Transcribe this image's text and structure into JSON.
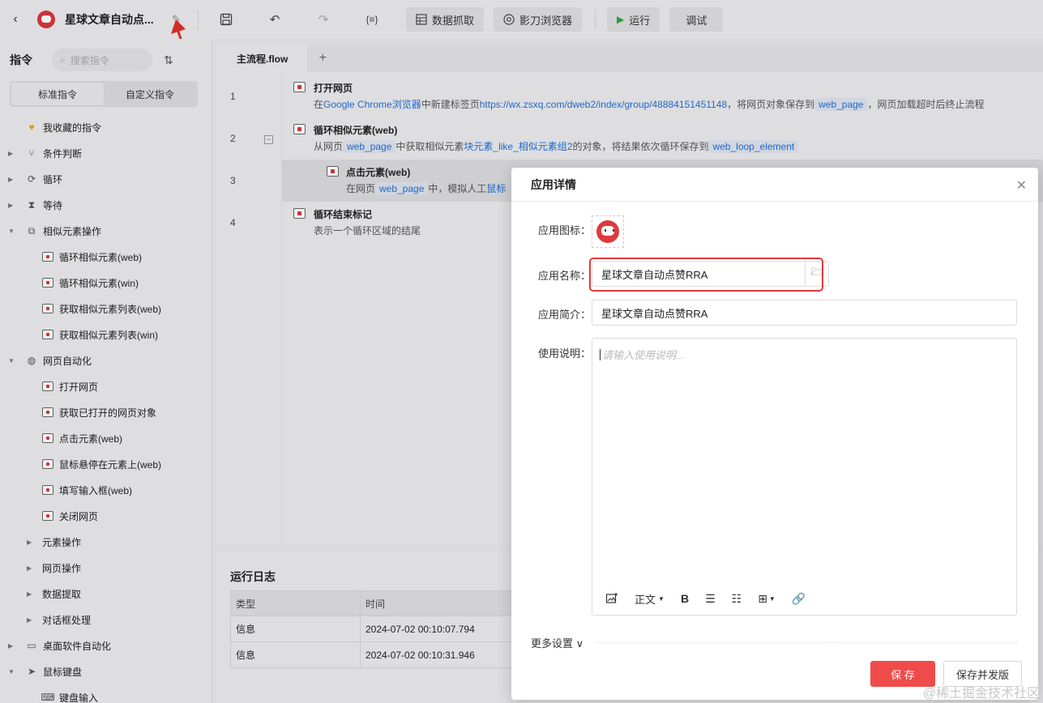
{
  "topbar": {
    "app_title": "星球文章自动点...",
    "extract_label": "数据抓取",
    "browser_label": "影刀浏览器",
    "run_label": "运行",
    "debug_label": "调试"
  },
  "sidebar": {
    "title": "指令",
    "search_placeholder": "搜索指令",
    "tabs": [
      "标准指令",
      "自定义指令"
    ],
    "items": [
      {
        "label": "我收藏的指令"
      },
      {
        "label": "条件判断"
      },
      {
        "label": "循环"
      },
      {
        "label": "等待"
      },
      {
        "label": "相似元素操作"
      },
      {
        "label": "循环相似元素(web)"
      },
      {
        "label": "循环相似元素(win)"
      },
      {
        "label": "获取相似元素列表(web)"
      },
      {
        "label": "获取相似元素列表(win)"
      },
      {
        "label": "网页自动化"
      },
      {
        "label": "打开网页"
      },
      {
        "label": "获取已打开的网页对象"
      },
      {
        "label": "点击元素(web)"
      },
      {
        "label": "鼠标悬停在元素上(web)"
      },
      {
        "label": "填写输入框(web)"
      },
      {
        "label": "关闭网页"
      },
      {
        "label": "元素操作"
      },
      {
        "label": "网页操作"
      },
      {
        "label": "数据提取"
      },
      {
        "label": "对话框处理"
      },
      {
        "label": "桌面软件自动化"
      },
      {
        "label": "鼠标键盘"
      },
      {
        "label": "键盘输入"
      }
    ]
  },
  "main": {
    "tab": "主流程.flow",
    "steps": [
      {
        "num": "1",
        "title": "打开网页",
        "d1": "在",
        "d2": "Google Chrome浏览器",
        "d3": "中新建标签页",
        "d4": "https://wx.zsxq.com/dweb2/index/group/48884151451148",
        "d5": "，将网页对象保存到",
        "d6": "web_page",
        "d7": "，网页加载超时后终止流程"
      },
      {
        "num": "2",
        "title": "循环相似元素(web)",
        "d1": "从网页",
        "d2": "web_page",
        "d3": "中获取相似元素",
        "d4": "块元素_like_相似元素组2",
        "d5": "的对象，将结果依次循环保存到",
        "d6": "web_loop_element"
      },
      {
        "num": "3",
        "title": "点击元素(web)",
        "d1": "在网页",
        "d2": "web_page",
        "d3": "中，模拟人工",
        "d4": "鼠标"
      },
      {
        "num": "4",
        "title": "循环结束标记",
        "d1": "表示一个循环区域的结尾"
      }
    ]
  },
  "log": {
    "title": "运行日志",
    "headers": [
      "类型",
      "时间"
    ],
    "rows": [
      [
        "信息",
        "2024-07-02 00:10:07.794"
      ],
      [
        "信息",
        "2024-07-02 00:10:31.946"
      ]
    ]
  },
  "modal": {
    "title": "应用详情",
    "icon_label": "应用图标：",
    "name_label": "应用名称：",
    "name_value": "星球文章自动点赞RRA",
    "intro_label": "应用简介：",
    "intro_value": "星球文章自动点赞RRA",
    "usage_label": "使用说明：",
    "usage_placeholder": "请输入使用说明...",
    "format_label": "正文",
    "more_settings": "更多设置",
    "save": "保 存",
    "save_publish": "保存并发版"
  },
  "watermark": "@稀土掘金技术社区",
  "colors": {
    "accent": "#f04b4b",
    "link": "#1e6fd9",
    "highlight": "#e03a3a"
  }
}
